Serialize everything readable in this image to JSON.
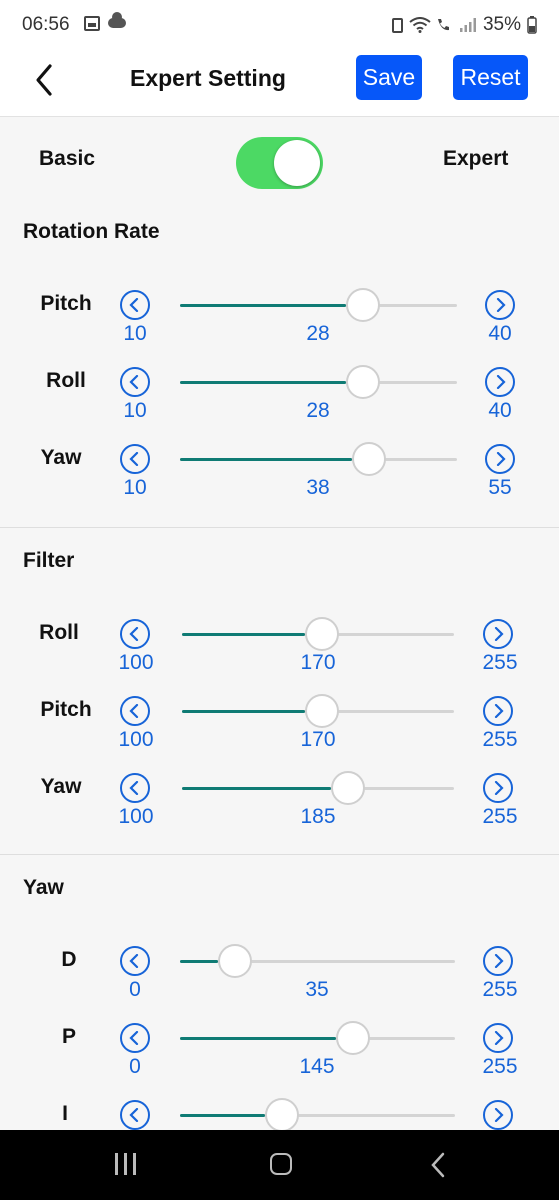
{
  "status": {
    "time": "06:56",
    "battery": "35%"
  },
  "header": {
    "title": "Expert Setting",
    "save_label": "Save",
    "reset_label": "Reset"
  },
  "mode": {
    "left_label": "Basic",
    "right_label": "Expert",
    "expert_enabled": true
  },
  "sections": [
    {
      "title": "Rotation Rate",
      "rows": [
        {
          "label": "Pitch",
          "min": "10",
          "value": "28",
          "max": "40",
          "fraction": 0.6
        },
        {
          "label": "Roll",
          "min": "10",
          "value": "28",
          "max": "40",
          "fraction": 0.6
        },
        {
          "label": "Yaw",
          "min": "10",
          "value": "38",
          "max": "55",
          "fraction": 0.622
        }
      ]
    },
    {
      "title": "Filter",
      "rows": [
        {
          "label": "Roll",
          "min": "100",
          "value": "170",
          "max": "255",
          "fraction": 0.452
        },
        {
          "label": "Pitch",
          "min": "100",
          "value": "170",
          "max": "255",
          "fraction": 0.452
        },
        {
          "label": "Yaw",
          "min": "100",
          "value": "185",
          "max": "255",
          "fraction": 0.548
        }
      ]
    },
    {
      "title": "Yaw",
      "rows": [
        {
          "label": "D",
          "min": "0",
          "value": "35",
          "max": "255",
          "fraction": 0.137
        },
        {
          "label": "P",
          "min": "0",
          "value": "145",
          "max": "255",
          "fraction": 0.569
        },
        {
          "label": "I",
          "min": "0",
          "value": "",
          "max": "",
          "fraction": 0.31
        }
      ]
    }
  ]
}
